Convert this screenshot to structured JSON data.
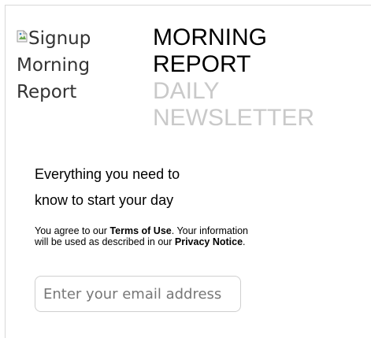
{
  "logo": {
    "alt_text": "Signup Morning Report"
  },
  "header": {
    "title_line1": "MORNING",
    "title_line2": "REPORT",
    "subtitle_line1": "DAILY",
    "subtitle_line2": "NEWSLETTER"
  },
  "tagline": {
    "line1": "Everything you need to",
    "line2": "know to start your day"
  },
  "legal": {
    "prefix": "You agree to our ",
    "terms_link": "Terms of Use",
    "middle": ". Your information will be used as described in our ",
    "privacy_link": "Privacy Notice",
    "suffix": "."
  },
  "signup": {
    "email_placeholder": "Enter your email address"
  }
}
